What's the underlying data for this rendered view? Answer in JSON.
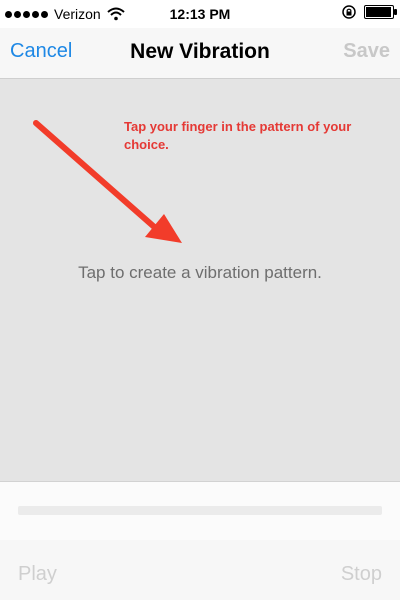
{
  "status_bar": {
    "carrier": "Verizon",
    "time": "12:13 PM",
    "signal_bars_filled": 5,
    "battery_level": 0.95
  },
  "nav": {
    "left_label": "Cancel",
    "title": "New Vibration",
    "right_label": "Save"
  },
  "canvas": {
    "hint": "Tap to create a vibration pattern."
  },
  "annotation": {
    "text": "Tap your finger in the pattern of your choice."
  },
  "toolbar": {
    "play_label": "Play",
    "stop_label": "Stop"
  },
  "colors": {
    "accent": "#1e88e5",
    "annotation": "#e53935",
    "disabled": "#c8c8c8",
    "canvas_bg": "#e4e4e4"
  },
  "icons": [
    "wifi-icon",
    "orientation-lock-icon",
    "battery-icon",
    "arrow-annotation-icon"
  ]
}
